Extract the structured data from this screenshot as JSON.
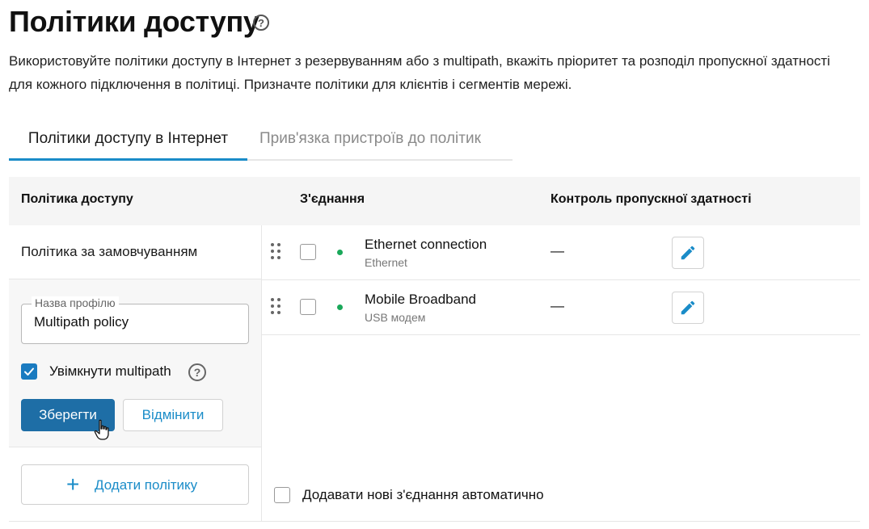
{
  "page": {
    "title": "Політики доступу",
    "description": "Використовуйте політики доступу в Інтернет з резервуванням або з multipath, вкажіть пріоритет та розподіл пропускної здатності для кожного підключення в політиці. Призначте політики для клієнтів і сегментів мережі."
  },
  "tabs": [
    {
      "label": "Політики доступу в Інтернет",
      "active": true
    },
    {
      "label": "Прив'язка пристроїв до політик",
      "active": false
    }
  ],
  "table": {
    "headers": {
      "policy": "Політика доступу",
      "connection": "З'єднання",
      "bandwidth": "Контроль пропускної здатності"
    }
  },
  "policies": [
    {
      "name": "Політика за замовчуванням"
    }
  ],
  "edit_form": {
    "legend": "Назва профілю",
    "value": "Multipath policy",
    "multipath_label": "Увімкнути multipath",
    "multipath_checked": true,
    "save_label": "Зберегти",
    "cancel_label": "Відмінити"
  },
  "add_policy_label": "Додати політику",
  "connections": [
    {
      "name": "Ethernet connection",
      "type": "Ethernet",
      "bandwidth": "—",
      "status_color": "#1aa85a"
    },
    {
      "name": "Mobile Broadband",
      "type": "USB модем",
      "bandwidth": "—",
      "status_color": "#1aa85a"
    }
  ],
  "auto_add_label": "Додавати нові з'єднання автоматично",
  "colors": {
    "accent": "#1a8cc8",
    "primary_button": "#1e6ea6",
    "status_online": "#1aa85a"
  }
}
